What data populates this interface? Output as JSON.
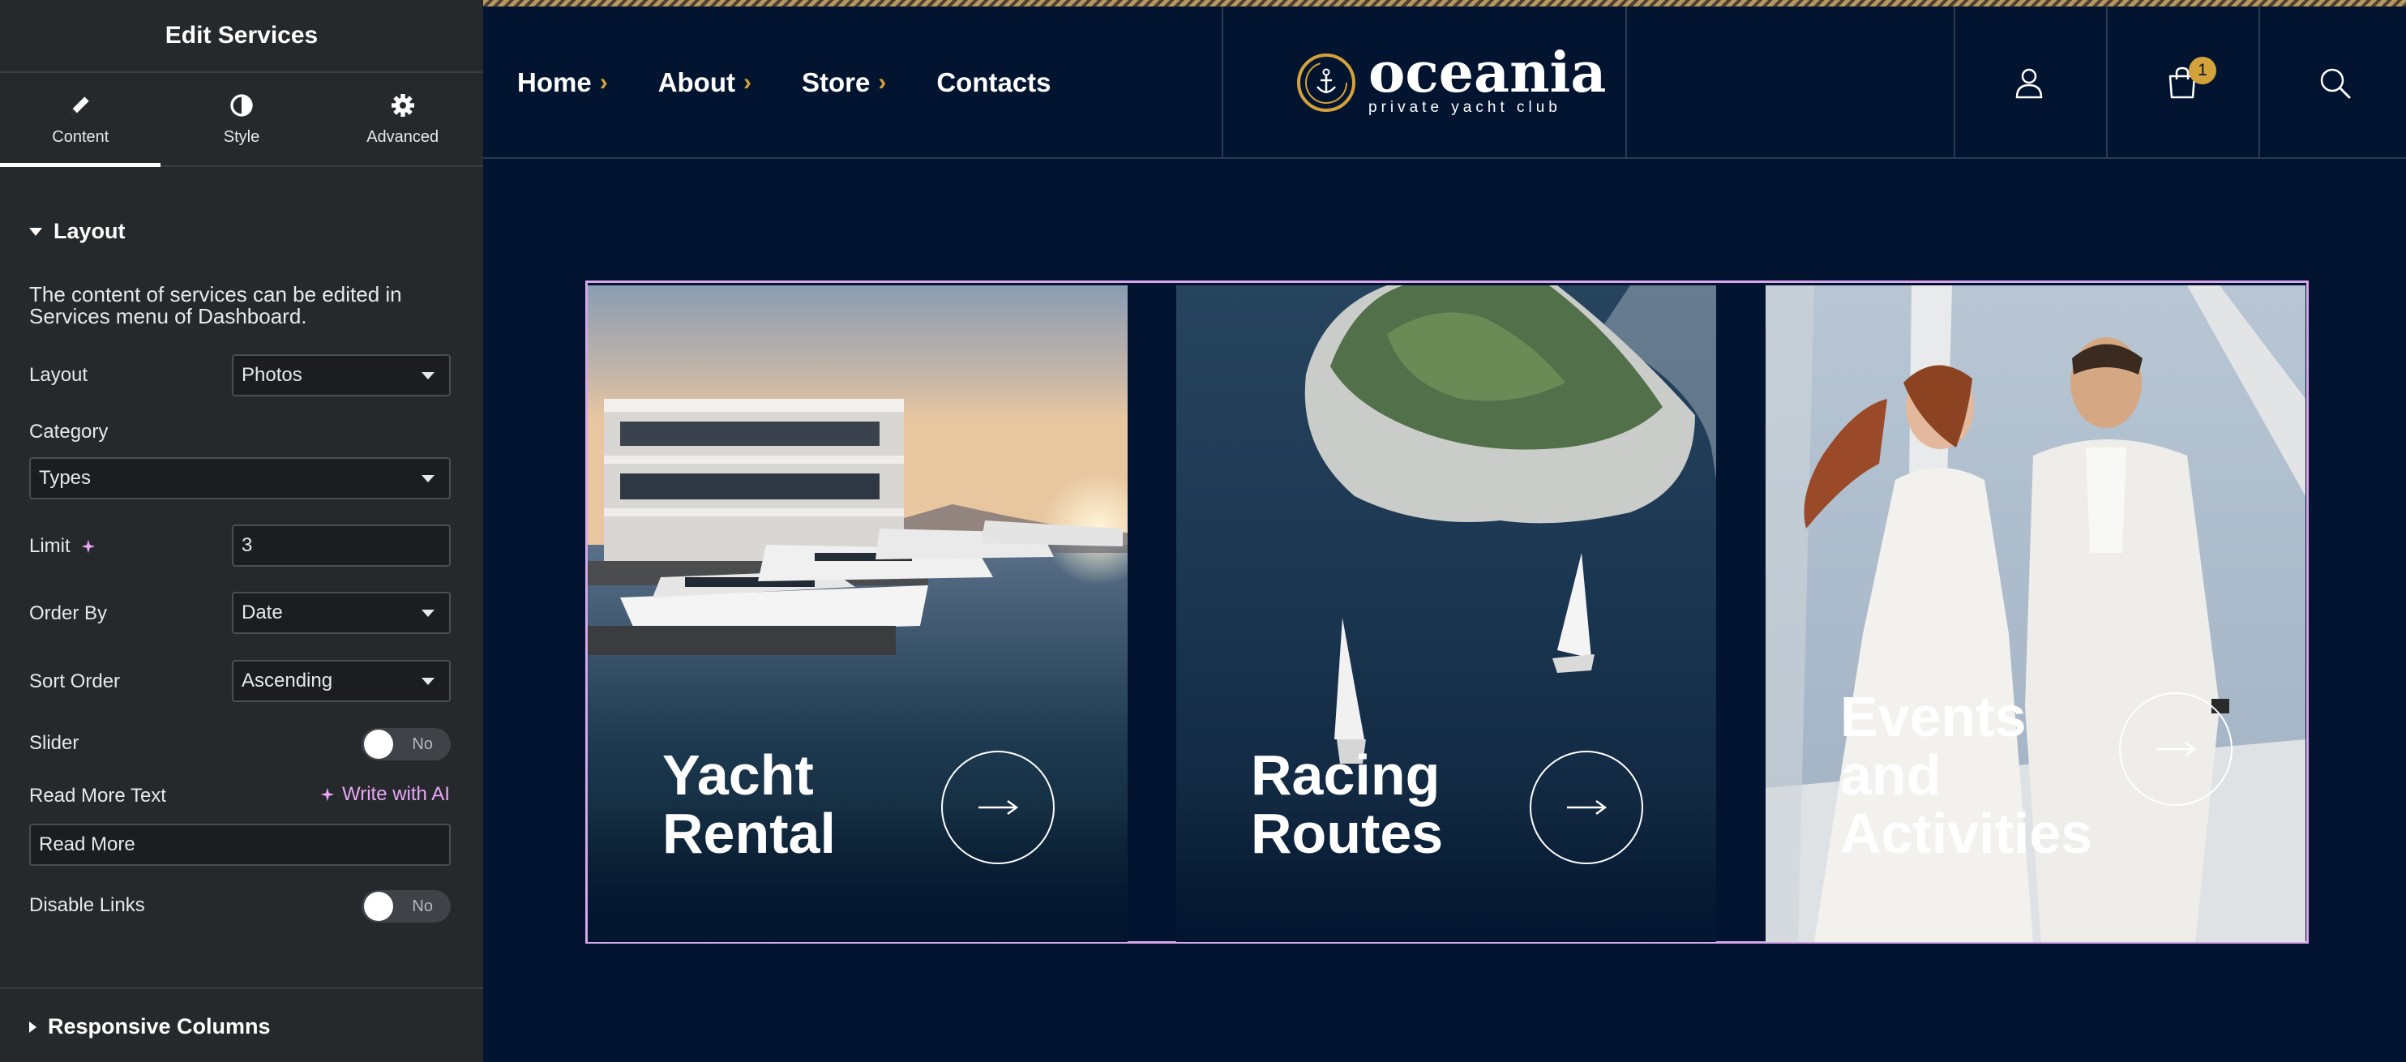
{
  "panel": {
    "title": "Edit Services",
    "tabs": [
      {
        "label": "Content",
        "icon": "pencil-icon"
      },
      {
        "label": "Style",
        "icon": "half-circle-icon"
      },
      {
        "label": "Advanced",
        "icon": "gear-icon"
      }
    ],
    "layout_section": "Layout",
    "note": "The content of services can be edited in Services menu of Dashboard.",
    "fields": {
      "layout": {
        "label": "Layout",
        "value": "Photos"
      },
      "category": {
        "label": "Category",
        "value": "Types"
      },
      "limit": {
        "label": "Limit",
        "value": "3"
      },
      "order_by": {
        "label": "Order By",
        "value": "Date"
      },
      "sort_order": {
        "label": "Sort Order",
        "value": "Ascending"
      },
      "slider": {
        "label": "Slider",
        "value": "No"
      },
      "read_more": {
        "label": "Read More Text",
        "value": "Read More",
        "ai_link": "Write with AI"
      },
      "disable_links": {
        "label": "Disable Links",
        "value": "No"
      }
    },
    "responsive_section": "Responsive Columns"
  },
  "site": {
    "nav": [
      {
        "label": "Home",
        "has_chevron": true
      },
      {
        "label": "About",
        "has_chevron": true
      },
      {
        "label": "Store",
        "has_chevron": true
      },
      {
        "label": "Contacts",
        "has_chevron": false
      }
    ],
    "logo": {
      "name": "oceania",
      "tagline": "private yacht club"
    },
    "cart_count": "1",
    "services": [
      {
        "title_line1": "Yacht",
        "title_line2": "Rental",
        "title_line3": ""
      },
      {
        "title_line1": "Racing",
        "title_line2": "Routes",
        "title_line3": ""
      },
      {
        "title_line1": "Events",
        "title_line2": "and",
        "title_line3": "Activities"
      }
    ],
    "colors": {
      "background": "#021430",
      "accent": "#d4a23a",
      "selection": "#d8a6ea"
    }
  }
}
